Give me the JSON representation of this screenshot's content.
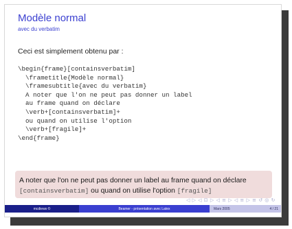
{
  "slide": {
    "title": "Modèle normal",
    "subtitle": "avec du verbatim",
    "intro": "Ceci est simplement obtenu par :",
    "code_lines": [
      "\\begin{frame}[containsverbatim]",
      "  \\frametitle{Modèle normal}",
      "  \\framesubtitle{avec du verbatim}",
      "  A noter que l'on ne peut pas donner un label",
      "  au frame quand on déclare",
      "  \\verb+[containsverbatim]+",
      "  ou quand on utilise l'option",
      "  \\verb+[fragile]+",
      "\\end{frame}"
    ],
    "alert": {
      "text_1": "A noter que l'on ne peut pas donner un label au frame quand on déclare",
      "code_1": "[containsverbatim]",
      "text_2": " ou quand on utilise l'option ",
      "code_2": "[fragile]"
    },
    "nav_symbols": "◁ ▷ ◁ ⊡ ▷ ◁ ≡ ▷ ◁ ≡ ▷ ≡ ↺ ◎ ↻"
  },
  "footer": {
    "author": "mcdiews ©",
    "talk_title": "Beamer - présentation avec Latex",
    "date": "Mars 2005",
    "page": "4 / 21"
  }
}
